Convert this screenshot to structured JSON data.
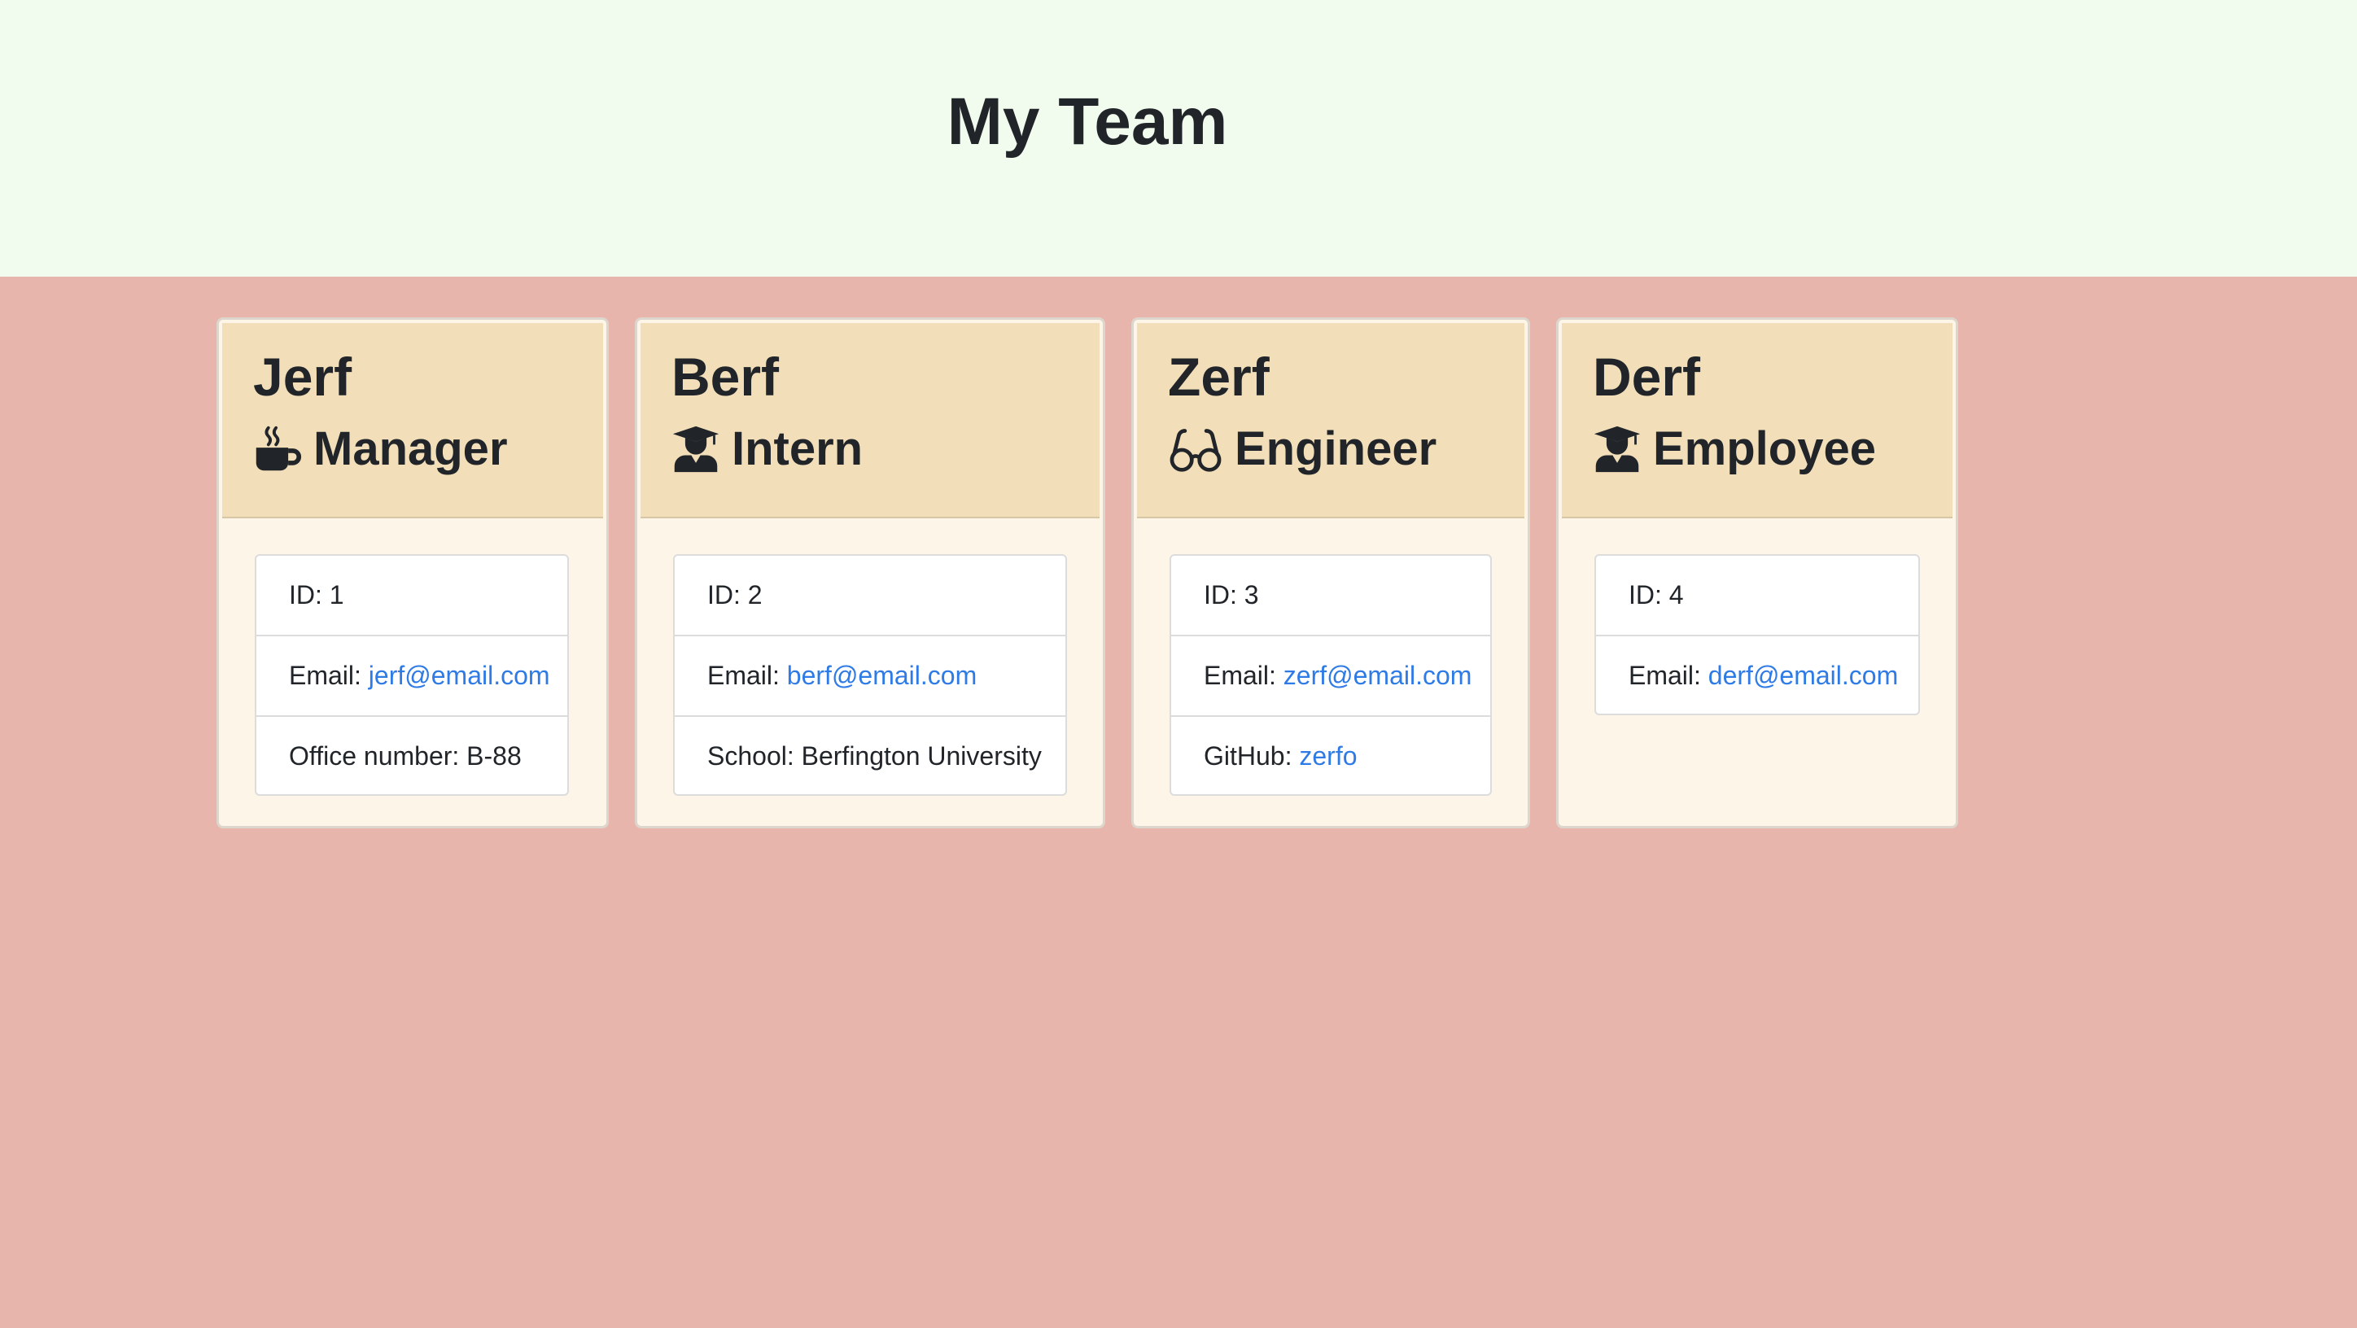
{
  "header": {
    "title": "My Team"
  },
  "team": [
    {
      "name": "Jerf",
      "role": "Manager",
      "icon": "coffee-mug-icon",
      "id_text": "ID: 1",
      "email_label": "Email: ",
      "email": "jerf@email.com",
      "extra_label": "Office number: B-88",
      "extra_link": ""
    },
    {
      "name": "Berf",
      "role": "Intern",
      "icon": "graduate-icon",
      "id_text": "ID: 2",
      "email_label": "Email: ",
      "email": "berf@email.com",
      "extra_label": "School: Berfington University",
      "extra_link": ""
    },
    {
      "name": "Zerf",
      "role": "Engineer",
      "icon": "glasses-icon",
      "id_text": "ID: 3",
      "email_label": "Email: ",
      "email": "zerf@email.com",
      "extra_label": "GitHub: ",
      "extra_link": "zerfo"
    },
    {
      "name": "Derf",
      "role": "Employee",
      "icon": "graduate-icon",
      "id_text": "ID: 4",
      "email_label": "Email: ",
      "email": "derf@email.com"
    }
  ],
  "colors": {
    "header_bg": "#f1fcef",
    "main_bg": "#e8b5ac",
    "card_bg": "#fdf5e8",
    "card_header_bg": "#f2deb9",
    "link": "#2f7be6"
  }
}
